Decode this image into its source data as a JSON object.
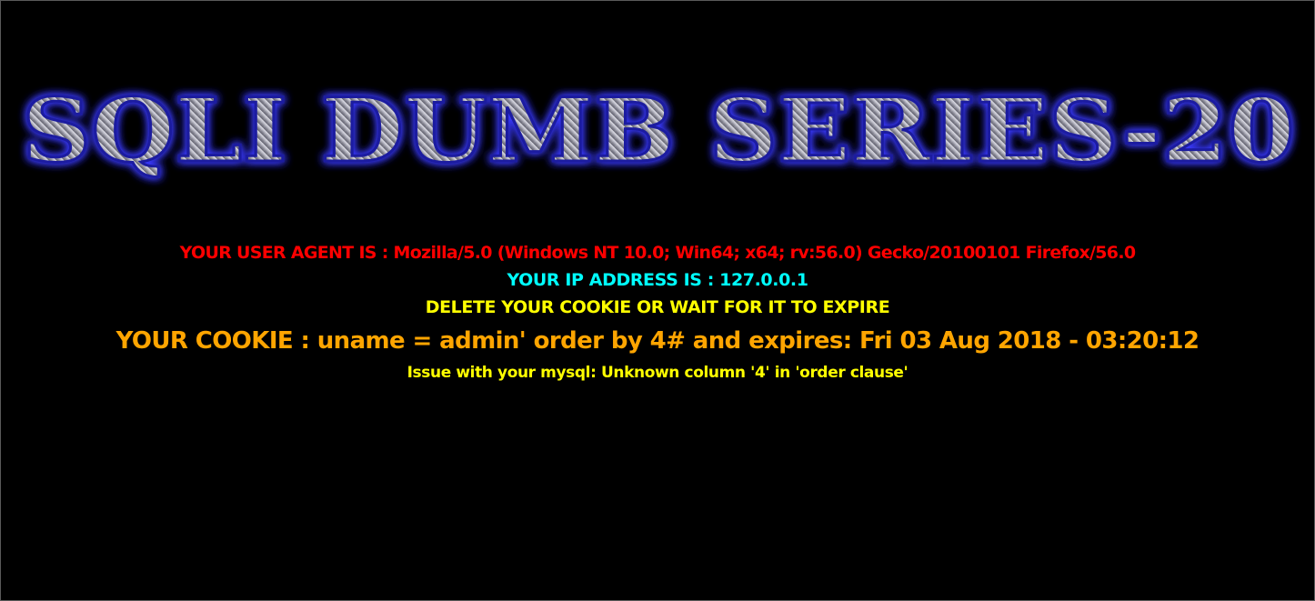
{
  "banner": {
    "title": "SQLI DUMB SERIES-20",
    "colors": {
      "glow": "#3a3aff",
      "fill_light": "#d8d8e0",
      "fill_dark": "#6c6c78"
    }
  },
  "info": {
    "user_agent": "YOUR USER AGENT IS : Mozilla/5.0 (Windows NT 10.0; Win64; x64; rv:56.0) Gecko/20100101 Firefox/56.0",
    "ip_address": "YOUR IP ADDRESS IS : 127.0.0.1",
    "delete_notice": "DELETE YOUR COOKIE OR WAIT FOR IT TO EXPIRE",
    "cookie": "YOUR COOKIE : uname = admin' order by 4# and expires: Fri 03 Aug 2018 - 03:20:12",
    "error": "Issue with your mysql: Unknown column '4' in 'order clause'",
    "colors": {
      "user_agent": "#ff0000",
      "ip_address": "#00ffff",
      "delete_notice": "#ffff00",
      "cookie": "#ffa500",
      "error": "#ffff00"
    }
  }
}
